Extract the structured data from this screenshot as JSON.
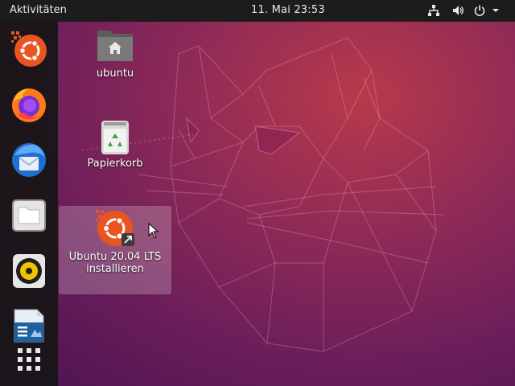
{
  "topbar": {
    "activities_label": "Aktivitäten",
    "clock": "11. Mai  23:53",
    "tray_icons": [
      "network-icon",
      "volume-icon",
      "power-icon",
      "chevron-down-icon"
    ]
  },
  "dock": {
    "items": [
      {
        "name": "ubuntu-installer",
        "icon": "ubuntu-installer-icon"
      },
      {
        "name": "firefox",
        "icon": "firefox-icon"
      },
      {
        "name": "thunderbird",
        "icon": "thunderbird-icon"
      },
      {
        "name": "files",
        "icon": "files-icon"
      },
      {
        "name": "rhythmbox",
        "icon": "rhythmbox-icon"
      },
      {
        "name": "libreoffice-writer",
        "icon": "libreoffice-writer-icon"
      },
      {
        "name": "show-applications",
        "icon": "app-grid-icon"
      }
    ]
  },
  "desktop": {
    "home_label": "ubuntu",
    "trash_label": "Papierkorb",
    "installer_label_line1": "Ubuntu 20.04 LTS",
    "installer_label_line2": "installieren"
  },
  "colors": {
    "topbar": "#1c1c1c",
    "dock": "#161616",
    "ubuntu_orange": "#e95420",
    "wallpaper_start": "#b83a4a",
    "wallpaper_end": "#4a1450"
  }
}
